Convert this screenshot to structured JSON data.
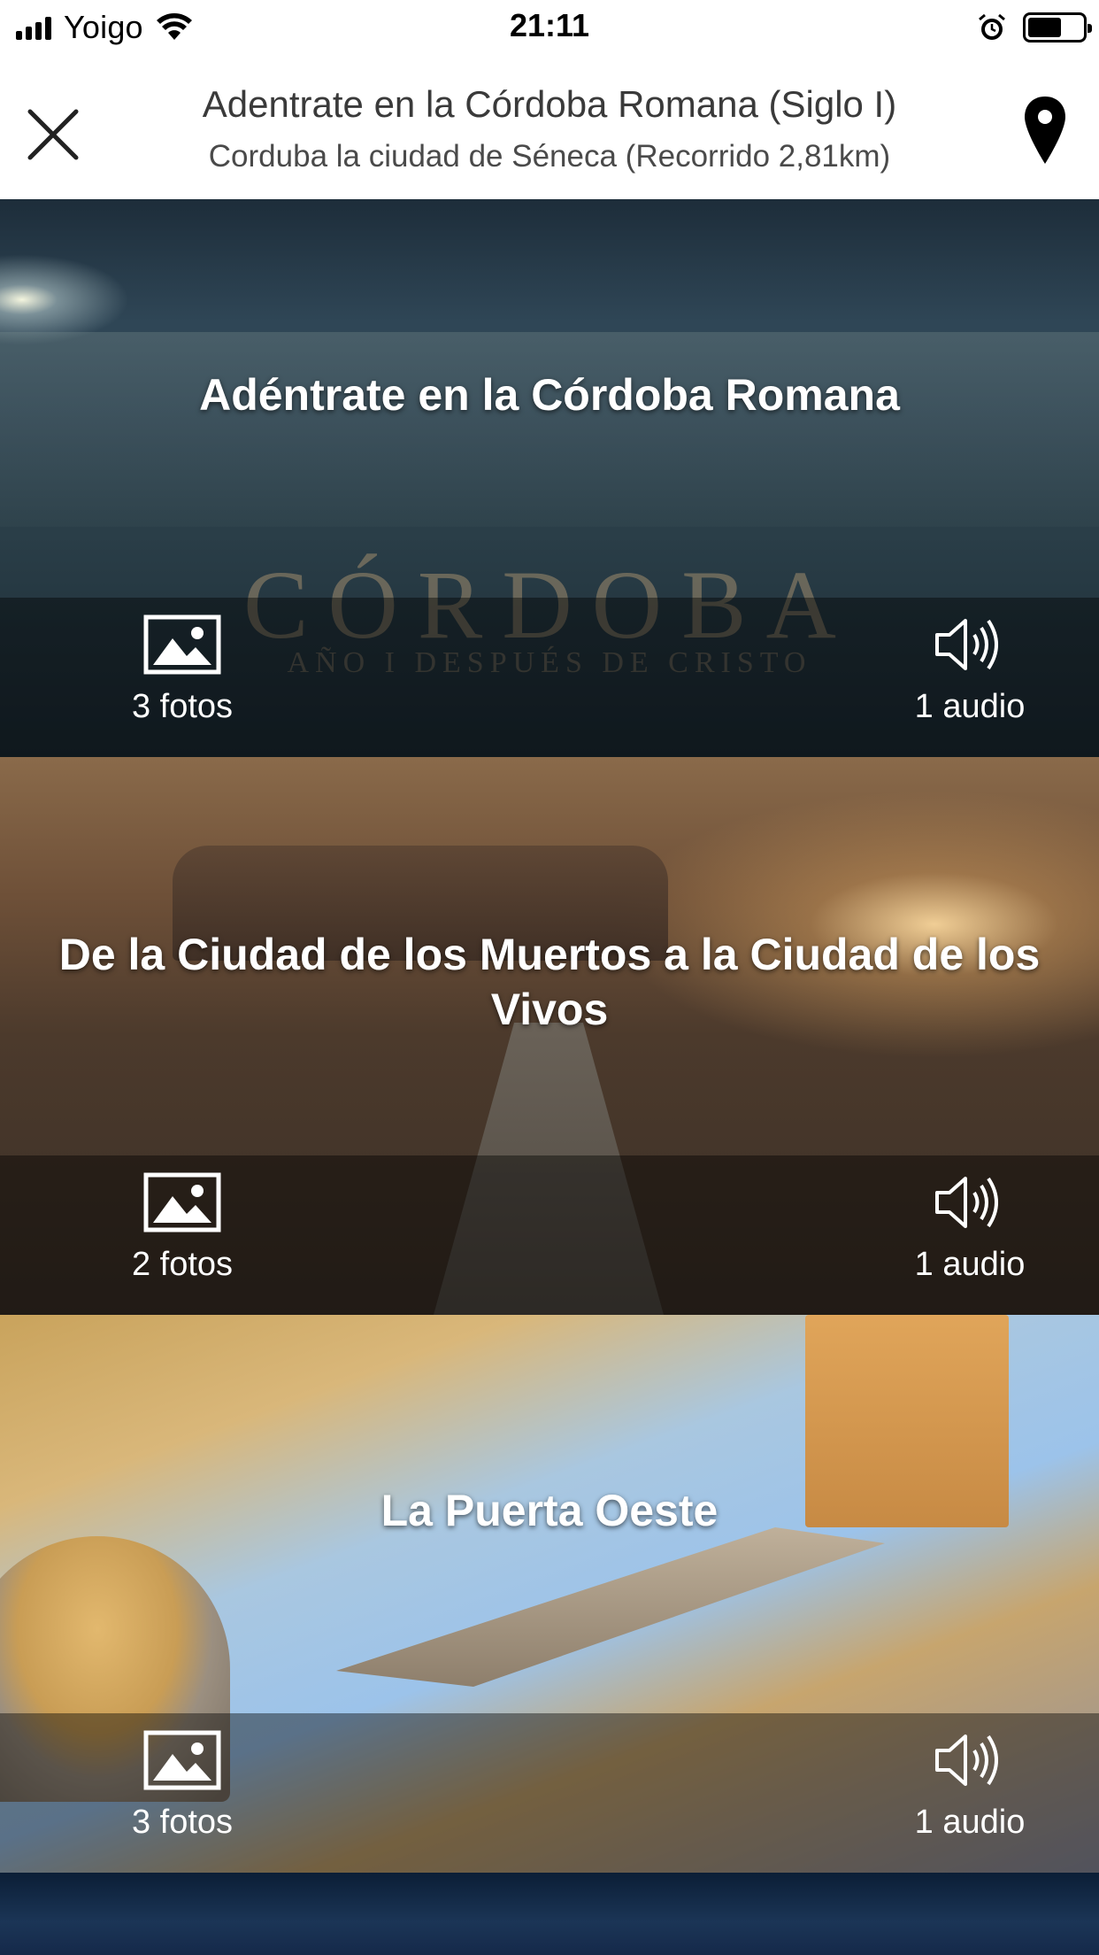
{
  "status_bar": {
    "carrier": "Yoigo",
    "time": "21:11",
    "battery_level": 0.62
  },
  "header": {
    "title": "Adentrate en la Córdoba Romana (Siglo I)",
    "subtitle": "Corduba la ciudad de Séneca (Recorrido 2,81km)"
  },
  "bg_text": {
    "card1_word": "CÓRDOBA",
    "card1_sub": "AÑO I DESPUÉS DE CRISTO"
  },
  "cards": [
    {
      "title": "Adéntrate en la Córdoba Romana",
      "photos": "3 fotos",
      "audio": "1 audio"
    },
    {
      "title": "De la Ciudad de los Muertos a la Ciudad de los Vivos",
      "photos": "2 fotos",
      "audio": "1 audio"
    },
    {
      "title": "La Puerta Oeste",
      "photos": "3 fotos",
      "audio": "1 audio"
    }
  ],
  "icons": {
    "close": "close-icon",
    "map": "map-pin-icon",
    "photos": "image-icon",
    "audio": "speaker-icon"
  },
  "colors": {
    "header_bg": "#ffffff",
    "header_text": "#3a3a3a",
    "card_text": "#ffffff"
  }
}
